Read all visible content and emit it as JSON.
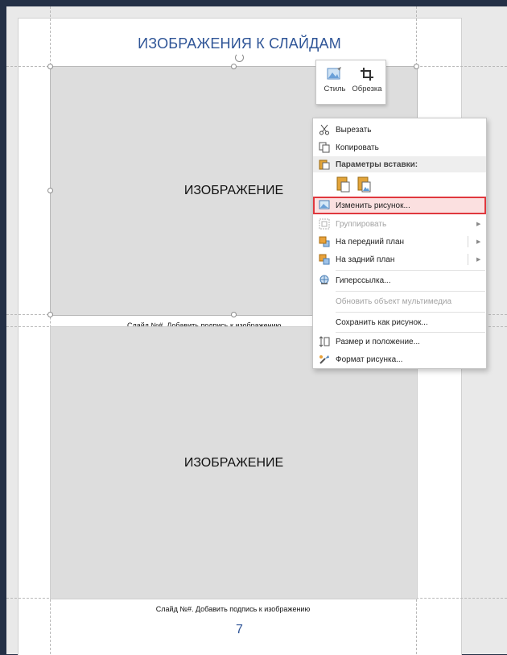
{
  "document": {
    "title": "ИЗОБРАЖЕНИЯ К СЛАЙДАМ",
    "image1_label": "ИЗОБРАЖЕНИЕ",
    "image2_label": "ИЗОБРАЖЕНИЕ",
    "caption1": "Слайд №#. Добавить подпись к изображению",
    "caption2": "Слайд №#. Добавить подпись к изображению",
    "page_number": "7"
  },
  "mini_toolbar": {
    "style_label": "Стиль",
    "crop_label": "Обрезка"
  },
  "context_menu": {
    "cut": "Вырезать",
    "copy": "Копировать",
    "paste_options_header": "Параметры вставки:",
    "change_picture": "Изменить рисунок...",
    "group": "Группировать",
    "bring_to_front": "На передний план",
    "send_to_back": "На задний план",
    "hyperlink": "Гиперссылка...",
    "update_media": "Обновить объект мультимедиа",
    "save_as_picture": "Сохранить как рисунок...",
    "size_position": "Размер и положение...",
    "format_picture": "Формат рисунка..."
  },
  "colors": {
    "title_blue": "#2f5597",
    "highlight_border": "#e0383e",
    "image_fill": "#dddddd"
  }
}
